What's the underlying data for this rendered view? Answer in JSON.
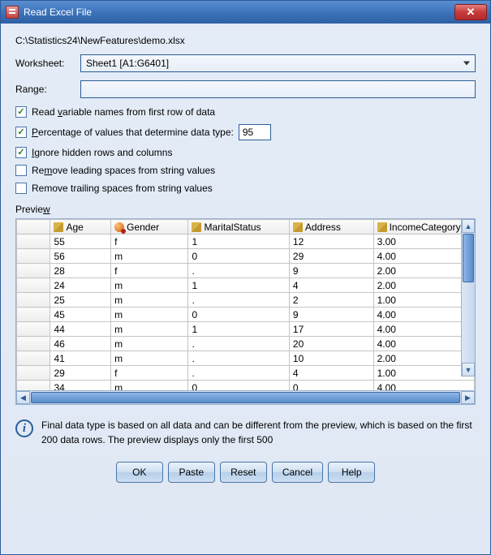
{
  "window": {
    "title": "Read Excel File"
  },
  "file_path": "C:\\Statistics24\\NewFeatures\\demo.xlsx",
  "worksheet": {
    "label": "Worksheet:",
    "value": "Sheet1 [A1:G6401]"
  },
  "range": {
    "label": "Range:",
    "value": ""
  },
  "options": {
    "read_varnames": {
      "label_pre": "Read ",
      "mnemonic": "v",
      "label_post": "ariable names from first row of data",
      "checked": true
    },
    "pct_values": {
      "label_pre": "",
      "mnemonic": "P",
      "label_post": "ercentage of values that determine data type:",
      "checked": true,
      "value": "95"
    },
    "ignore_hidden": {
      "label_pre": "",
      "mnemonic": "I",
      "label_post": "gnore hidden rows and columns",
      "checked": true
    },
    "remove_leading": {
      "label_pre": "Re",
      "mnemonic": "m",
      "label_post": "ove leading spaces from string values",
      "checked": false
    },
    "remove_trailing": {
      "label_pre": "Remove trailin",
      "mnemonic": "g",
      "label_post": " spaces from string values",
      "checked": false
    }
  },
  "preview_label_pre": "Previe",
  "preview_label_mn": "w",
  "preview": {
    "columns": [
      {
        "name": "Age",
        "type": "scale"
      },
      {
        "name": "Gender",
        "type": "nominal"
      },
      {
        "name": "MaritalStatus",
        "type": "scale"
      },
      {
        "name": "Address",
        "type": "scale"
      },
      {
        "name": "IncomeCategory",
        "type": "scale"
      }
    ],
    "rows": [
      [
        "55",
        "f",
        "1",
        "12",
        "3.00"
      ],
      [
        "56",
        "m",
        "0",
        "29",
        "4.00"
      ],
      [
        "28",
        "  f",
        ".",
        "9",
        "2.00"
      ],
      [
        "24",
        "m",
        "1",
        "4",
        "2.00"
      ],
      [
        "25",
        "   m",
        ".",
        "2",
        "1.00"
      ],
      [
        "45",
        "m",
        "0",
        "9",
        "4.00"
      ],
      [
        "44",
        "m",
        "1",
        "17",
        "4.00"
      ],
      [
        "46",
        "m",
        ".",
        "20",
        "4.00"
      ],
      [
        "41",
        "m",
        ".",
        "10",
        "2.00"
      ],
      [
        "29",
        "f",
        ".",
        "4",
        "1.00"
      ],
      [
        "34",
        "m",
        "0",
        "0",
        "4.00"
      ]
    ]
  },
  "info_text": "Final data type is based on all data and can be different from the preview, which is based on the first 200 data rows. The preview displays only the first 500",
  "buttons": {
    "ok": "OK",
    "paste": "Paste",
    "reset": "Reset",
    "cancel": "Cancel",
    "help": "Help"
  }
}
